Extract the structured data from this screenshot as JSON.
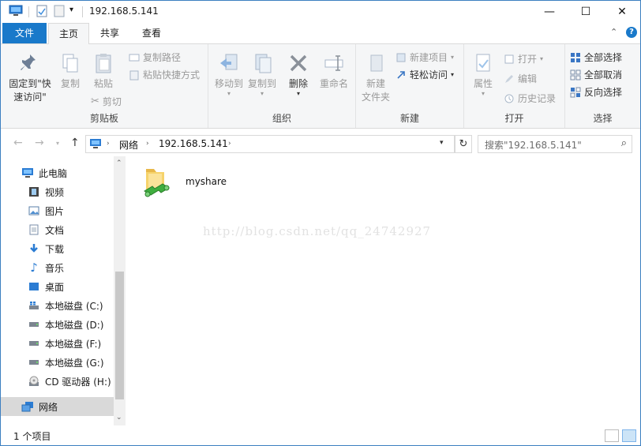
{
  "window": {
    "title": "192.168.5.141",
    "minimize": "—",
    "maximize": "☐",
    "close": "✕"
  },
  "ribbon_tabs": {
    "file": "文件",
    "home": "主页",
    "share": "共享",
    "view": "查看"
  },
  "ribbon": {
    "clipboard": {
      "label": "剪贴板",
      "pin_line1": "固定到\"快",
      "pin_line2": "速访问\"",
      "copy": "复制",
      "paste": "粘贴",
      "copy_path": "复制路径",
      "paste_shortcut": "粘贴快捷方式",
      "cut": "剪切"
    },
    "organize": {
      "label": "组织",
      "move_to": "移动到",
      "copy_to": "复制到",
      "delete": "删除",
      "rename": "重命名"
    },
    "new": {
      "label": "新建",
      "new_folder_line1": "新建",
      "new_folder_line2": "文件夹",
      "new_item": "新建项目",
      "easy_access": "轻松访问"
    },
    "open": {
      "label": "打开",
      "properties": "属性",
      "open": "打开",
      "edit": "编辑",
      "history": "历史记录"
    },
    "select": {
      "label": "选择",
      "select_all": "全部选择",
      "select_none": "全部取消",
      "invert": "反向选择"
    }
  },
  "address": {
    "crumbs": [
      "网络",
      "192.168.5.141"
    ],
    "search_placeholder": "搜索\"192.168.5.141\""
  },
  "nav_pane": {
    "items": [
      {
        "label": "此电脑",
        "icon": "pc-icon"
      },
      {
        "label": "视频",
        "icon": "video-icon"
      },
      {
        "label": "图片",
        "icon": "pictures-icon"
      },
      {
        "label": "文档",
        "icon": "documents-icon"
      },
      {
        "label": "下载",
        "icon": "download-icon"
      },
      {
        "label": "音乐",
        "icon": "music-icon"
      },
      {
        "label": "桌面",
        "icon": "desktop-icon"
      },
      {
        "label": "本地磁盘 (C:)",
        "icon": "windows-drive-icon"
      },
      {
        "label": "本地磁盘 (D:)",
        "icon": "drive-icon"
      },
      {
        "label": "本地磁盘 (F:)",
        "icon": "drive-icon"
      },
      {
        "label": "本地磁盘 (G:)",
        "icon": "drive-icon"
      },
      {
        "label": "CD 驱动器 (H:)",
        "icon": "cd-drive-icon"
      },
      {
        "label": "网络",
        "icon": "network-icon",
        "selected": true
      }
    ]
  },
  "content": {
    "items": [
      {
        "name": "myshare",
        "icon": "shared-folder-icon"
      }
    ],
    "watermark": "http://blog.csdn.net/qq_24742927"
  },
  "status": {
    "item_count": "1 个项目"
  },
  "colors": {
    "accent": "#1979ca",
    "selected_nav": "#d9d9d9",
    "ribbon_bg": "#f5f6f7"
  }
}
